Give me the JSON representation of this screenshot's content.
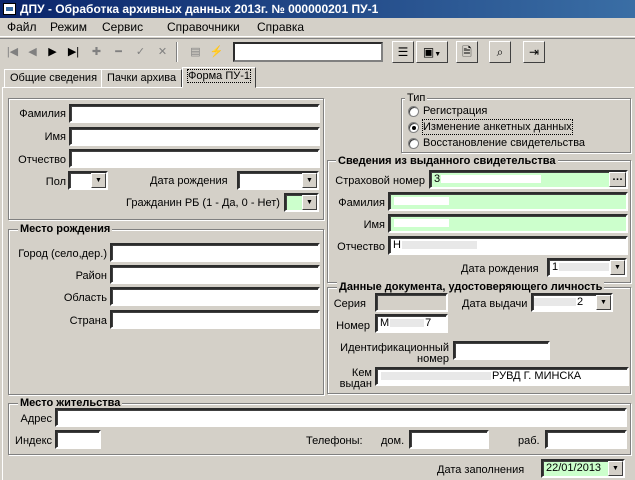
{
  "window": {
    "title": "ДПУ - Обработка архивных данных  2013г. № 000000201 ПУ-1"
  },
  "menu": [
    "Файл",
    "Режим",
    "Сервис",
    "Справочники",
    "Справка"
  ],
  "toolbar": {
    "combo_value": ""
  },
  "tabs": [
    "Общие сведения",
    "Пачки архива",
    "Форма ПУ-1"
  ],
  "person": {
    "labels": {
      "surname": "Фамилия",
      "name": "Имя",
      "patronymic": "Отчество",
      "sex": "Пол",
      "dob": "Дата рождения",
      "citizen": "Гражданин РБ (1 - Да, 0 - Нет)"
    }
  },
  "type": {
    "title": "Тип",
    "options": [
      "Регистрация",
      "Изменение анкетных данных",
      "Восстановление свидетельства"
    ],
    "selected": 1
  },
  "birthplace": {
    "title": "Место рождения",
    "labels": [
      "Город (село,дер.)",
      "Район",
      "Область",
      "Страна"
    ]
  },
  "certificate": {
    "title": "Сведения из выданного свидетельства",
    "labels": {
      "ins": "Страховой номер",
      "surname": "Фамилия",
      "name": "Имя",
      "patronymic": "Отчество",
      "dob": "Дата рождения"
    },
    "values": {
      "ins": "3",
      "patronymic_prefix": "Н",
      "dob_prefix": "1"
    }
  },
  "iddoc": {
    "title": "Данные документа, удостоверяющего личность",
    "labels": {
      "series": "Серия",
      "issue_date": "Дата выдачи",
      "number": "Номер",
      "idnum": "Идентификационный",
      "idnum2": "номер",
      "issuer1": "Кем",
      "issuer2": "выдан"
    },
    "values": {
      "issue_date_suffix": "2",
      "number_prefix": "М",
      "number_suffix": "7",
      "issuer_suffix": "РУВД Г. МИНСКА"
    }
  },
  "residence": {
    "title": "Место жительства",
    "labels": {
      "address": "Адрес",
      "index": "Индекс",
      "phones": "Телефоны:",
      "home": "дом.",
      "work": "раб."
    }
  },
  "footer": {
    "fill_date_label": "Дата заполнения",
    "fill_date": "22/01/2013"
  },
  "colors": {
    "highlight": "#ccffcc",
    "title_bar": "#0a246a"
  }
}
